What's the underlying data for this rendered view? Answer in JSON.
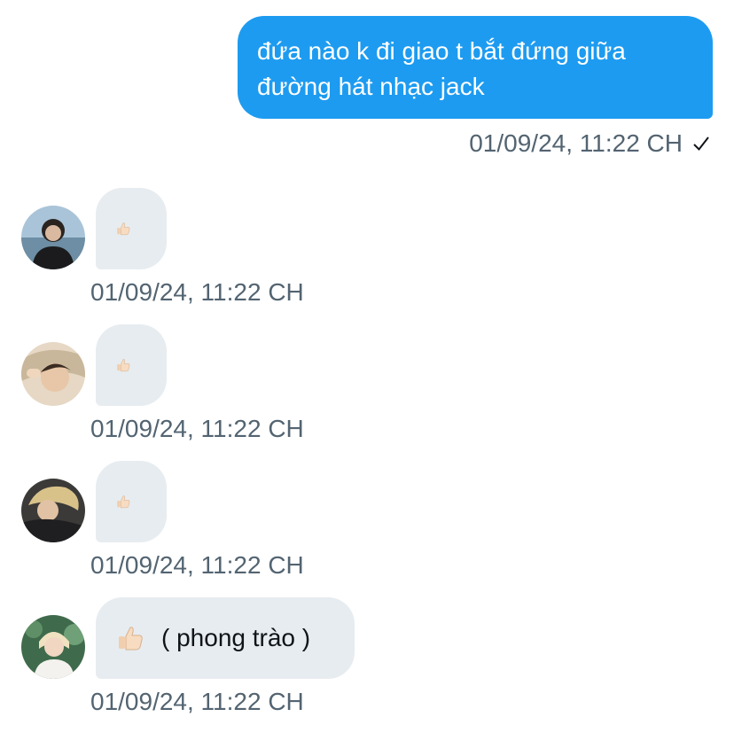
{
  "sent_message": {
    "text": "đứa nào k đi giao t bắt đứng giữa đường hát nhạc jack",
    "time": "01/09/24, 11:22 CH",
    "status_icon": "checkmark-icon"
  },
  "received_messages": [
    {
      "avatar": "avatar-user-1",
      "content_icon": "thumbs-up-emoji",
      "text": "",
      "time": "01/09/24, 11:22 CH"
    },
    {
      "avatar": "avatar-user-2",
      "content_icon": "thumbs-up-emoji",
      "text": "",
      "time": "01/09/24, 11:22 CH"
    },
    {
      "avatar": "avatar-user-3",
      "content_icon": "thumbs-up-emoji",
      "text": "",
      "time": "01/09/24, 11:22 CH"
    },
    {
      "avatar": "avatar-user-4",
      "content_icon": "thumbs-up-emoji",
      "text": "( phong trào )",
      "time": "01/09/24, 11:22 CH"
    }
  ],
  "colors": {
    "sent_bubble": "#1d9bf0",
    "received_bubble": "#e7ecf0",
    "timestamp": "#536471"
  }
}
